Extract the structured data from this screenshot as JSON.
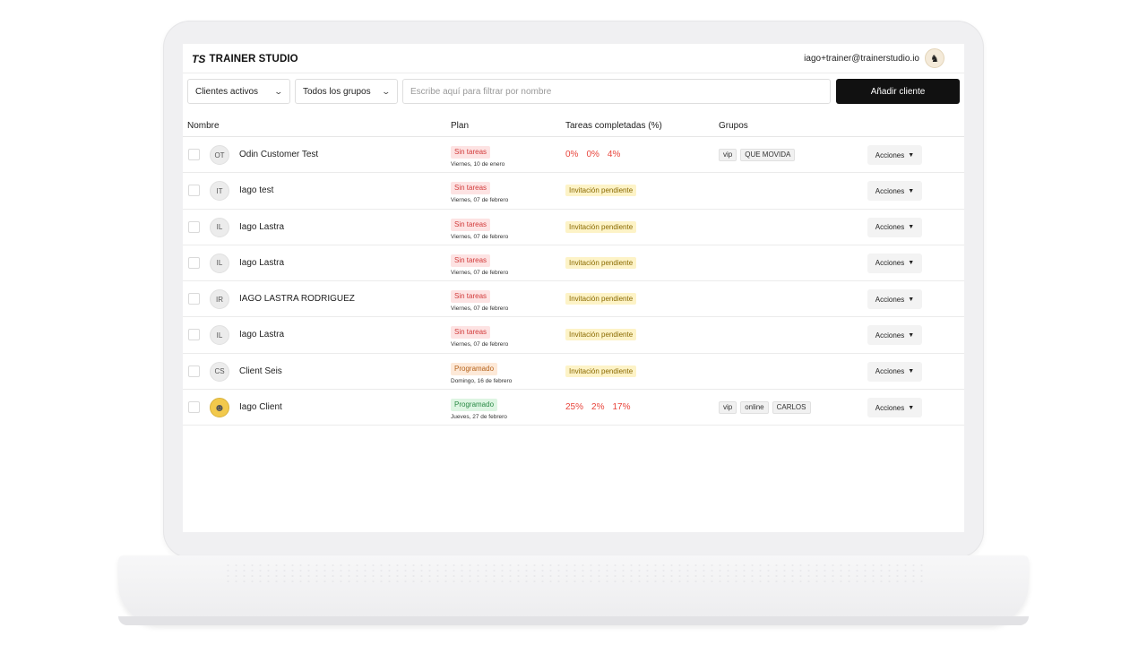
{
  "header": {
    "logo_mark": "TS",
    "brand": "TRAINER STUDIO",
    "user_email": "iago+trainer@trainerstudio.io"
  },
  "toolbar": {
    "status_filter": "Clientes activos",
    "group_filter": "Todos los grupos",
    "search_placeholder": "Escribe aquí para filtrar por nombre",
    "add_button": "Añadir cliente"
  },
  "table": {
    "columns": [
      "Nombre",
      "Plan",
      "Tareas completadas (%)",
      "Grupos"
    ],
    "actions_label": "Acciones",
    "rows": [
      {
        "initials": "OT",
        "name": "Odin Customer Test",
        "plan_status": "Sin tareas",
        "plan_color": "red",
        "plan_date": "Viernes, 10 de enero",
        "tasks": [
          "0%",
          "0%",
          "4%"
        ],
        "pending": null,
        "groups": [
          "vip",
          "QUE MOVIDA"
        ]
      },
      {
        "initials": "IT",
        "name": "Iago test",
        "plan_status": "Sin tareas",
        "plan_color": "red",
        "plan_date": "Viernes, 07 de febrero",
        "tasks": null,
        "pending": "Invitación pendiente",
        "groups": []
      },
      {
        "initials": "IL",
        "name": "Iago Lastra",
        "plan_status": "Sin tareas",
        "plan_color": "red",
        "plan_date": "Viernes, 07 de febrero",
        "tasks": null,
        "pending": "Invitación pendiente",
        "groups": []
      },
      {
        "initials": "IL",
        "name": "Iago Lastra",
        "plan_status": "Sin tareas",
        "plan_color": "red",
        "plan_date": "Viernes, 07 de febrero",
        "tasks": null,
        "pending": "Invitación pendiente",
        "groups": []
      },
      {
        "initials": "IR",
        "name": "IAGO LASTRA RODRIGUEZ",
        "plan_status": "Sin tareas",
        "plan_color": "red",
        "plan_date": "Viernes, 07 de febrero",
        "tasks": null,
        "pending": "Invitación pendiente",
        "groups": []
      },
      {
        "initials": "IL",
        "name": "Iago Lastra",
        "plan_status": "Sin tareas",
        "plan_color": "red",
        "plan_date": "Viernes, 07 de febrero",
        "tasks": null,
        "pending": "Invitación pendiente",
        "groups": []
      },
      {
        "initials": "CS",
        "name": "Client Seis",
        "plan_status": "Programado",
        "plan_color": "orange",
        "plan_date": "Domingo, 16 de febrero",
        "tasks": null,
        "pending": "Invitación pendiente",
        "groups": []
      },
      {
        "initials": "",
        "photo": true,
        "name": "Iago Client",
        "plan_status": "Programado",
        "plan_color": "green",
        "plan_date": "Jueves, 27 de febrero",
        "tasks": [
          "25%",
          "2%",
          "17%"
        ],
        "pending": null,
        "groups": [
          "vip",
          "online",
          "CARLOS"
        ]
      }
    ]
  }
}
